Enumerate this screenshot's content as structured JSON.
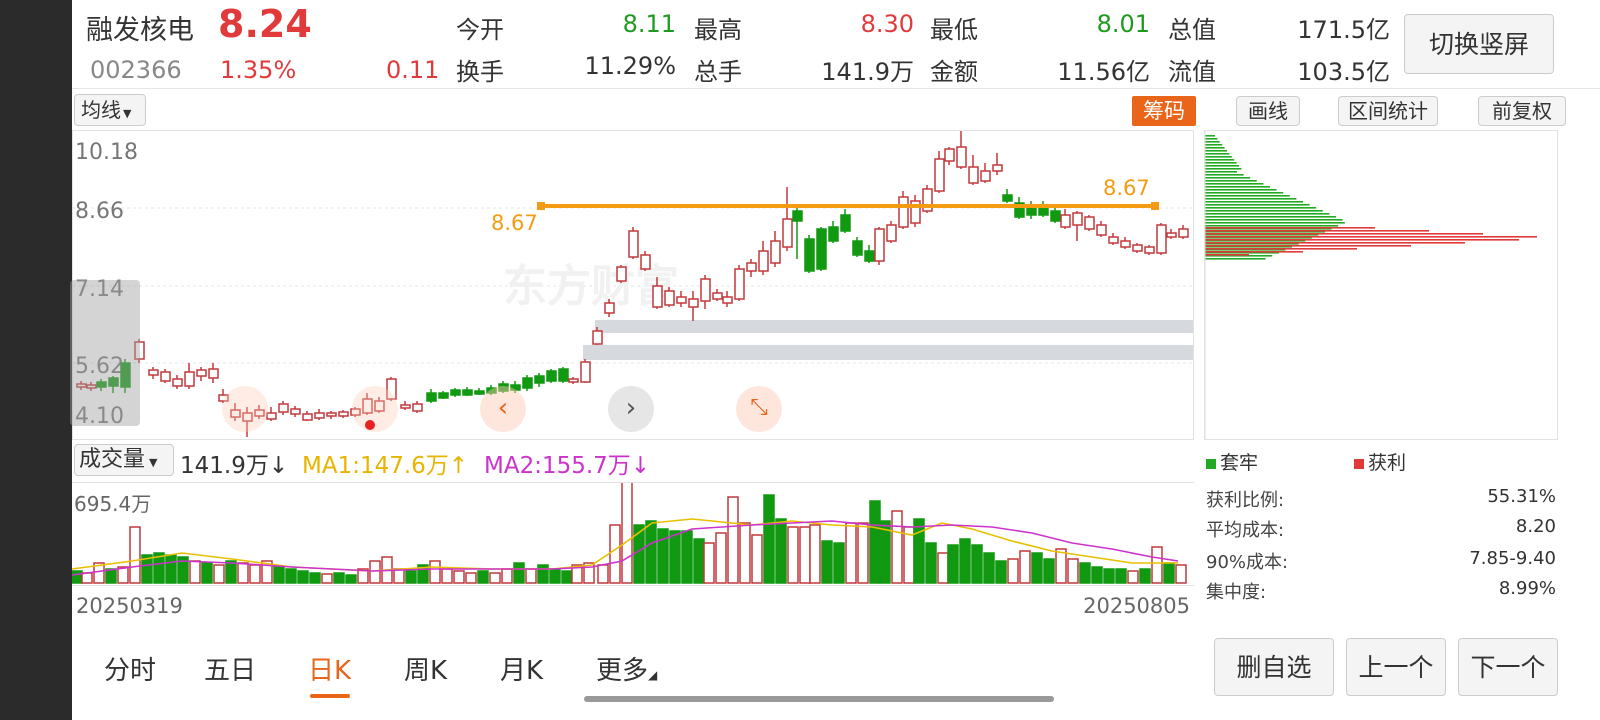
{
  "header": {
    "name": "融发核电",
    "price": "8.24",
    "code": "002366",
    "change_pct": "1.35%",
    "change_amt": "0.11",
    "stats": [
      {
        "label": "今开",
        "value": "8.11",
        "color": "green"
      },
      {
        "label": "最高",
        "value": "8.30",
        "color": "red"
      },
      {
        "label": "最低",
        "value": "8.01",
        "color": "green"
      },
      {
        "label": "总值",
        "value": "171.5亿",
        "color": "dark"
      },
      {
        "label": "换手",
        "value": "11.29%",
        "color": "dark"
      },
      {
        "label": "总手",
        "value": "141.9万",
        "color": "dark"
      },
      {
        "label": "金额",
        "value": "11.56亿",
        "color": "dark"
      },
      {
        "label": "流值",
        "value": "103.5亿",
        "color": "dark"
      }
    ],
    "switch_button": "切换竖屏"
  },
  "toolbar": {
    "ma_dropdown": "均线",
    "chips_button": "筹码",
    "draw_button": "画线",
    "range_stats_button": "区间统计",
    "adjust_button": "前复权"
  },
  "price_chart": {
    "y_ticks": [
      "10.18",
      "8.66",
      "7.14",
      "5.62",
      "4.10"
    ],
    "hline_label_left": "8.67",
    "hline_label_right": "8.67",
    "watermark": "东方财富"
  },
  "volume": {
    "indicator_dropdown": "成交量",
    "current": "141.9万",
    "current_arrow": "↓",
    "ma1": "MA1:147.6万",
    "ma1_arrow": "↑",
    "ma2": "MA2:155.7万",
    "ma2_arrow": "↓",
    "max_label": "695.4万",
    "start_date": "20250319",
    "end_date": "20250805"
  },
  "chip_panel": {
    "legend_locked": "套牢",
    "legend_profit": "获利",
    "stats": [
      {
        "label": "获利比例:",
        "value": "55.31%"
      },
      {
        "label": "平均成本:",
        "value": "8.20"
      },
      {
        "label": "90%成本:",
        "value": "7.85-9.40"
      },
      {
        "label": "集中度:",
        "value": "8.99%"
      }
    ]
  },
  "period_tabs": [
    "分时",
    "五日",
    "日K",
    "周K",
    "月K",
    "更多"
  ],
  "active_tab": 2,
  "bottom_buttons": {
    "remove": "删自选",
    "prev": "上一个",
    "next": "下一个"
  },
  "colors": {
    "up": "#c0393b",
    "down": "#119911",
    "accent": "#e8651a",
    "hline": "#f39c12",
    "ma1": "#e8c000",
    "ma2": "#cc33cc"
  }
}
